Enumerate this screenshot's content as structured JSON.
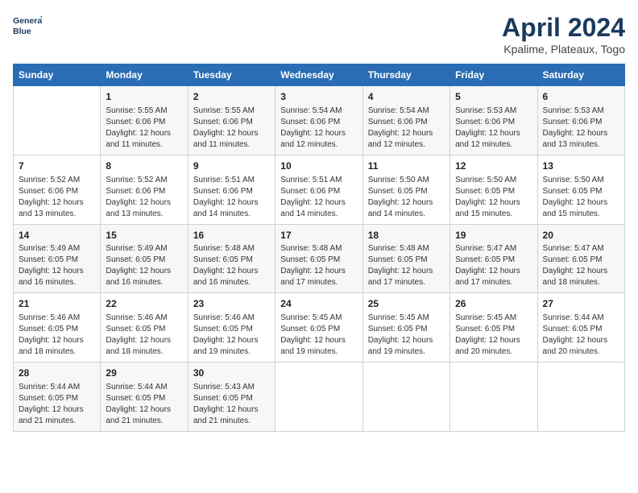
{
  "header": {
    "logo_line1": "General",
    "logo_line2": "Blue",
    "month_title": "April 2024",
    "location": "Kpalime, Plateaux, Togo"
  },
  "days_of_week": [
    "Sunday",
    "Monday",
    "Tuesday",
    "Wednesday",
    "Thursday",
    "Friday",
    "Saturday"
  ],
  "weeks": [
    [
      {
        "day": "",
        "info": ""
      },
      {
        "day": "1",
        "info": "Sunrise: 5:55 AM\nSunset: 6:06 PM\nDaylight: 12 hours\nand 11 minutes."
      },
      {
        "day": "2",
        "info": "Sunrise: 5:55 AM\nSunset: 6:06 PM\nDaylight: 12 hours\nand 11 minutes."
      },
      {
        "day": "3",
        "info": "Sunrise: 5:54 AM\nSunset: 6:06 PM\nDaylight: 12 hours\nand 12 minutes."
      },
      {
        "day": "4",
        "info": "Sunrise: 5:54 AM\nSunset: 6:06 PM\nDaylight: 12 hours\nand 12 minutes."
      },
      {
        "day": "5",
        "info": "Sunrise: 5:53 AM\nSunset: 6:06 PM\nDaylight: 12 hours\nand 12 minutes."
      },
      {
        "day": "6",
        "info": "Sunrise: 5:53 AM\nSunset: 6:06 PM\nDaylight: 12 hours\nand 13 minutes."
      }
    ],
    [
      {
        "day": "7",
        "info": "Sunrise: 5:52 AM\nSunset: 6:06 PM\nDaylight: 12 hours\nand 13 minutes."
      },
      {
        "day": "8",
        "info": "Sunrise: 5:52 AM\nSunset: 6:06 PM\nDaylight: 12 hours\nand 13 minutes."
      },
      {
        "day": "9",
        "info": "Sunrise: 5:51 AM\nSunset: 6:06 PM\nDaylight: 12 hours\nand 14 minutes."
      },
      {
        "day": "10",
        "info": "Sunrise: 5:51 AM\nSunset: 6:06 PM\nDaylight: 12 hours\nand 14 minutes."
      },
      {
        "day": "11",
        "info": "Sunrise: 5:50 AM\nSunset: 6:05 PM\nDaylight: 12 hours\nand 14 minutes."
      },
      {
        "day": "12",
        "info": "Sunrise: 5:50 AM\nSunset: 6:05 PM\nDaylight: 12 hours\nand 15 minutes."
      },
      {
        "day": "13",
        "info": "Sunrise: 5:50 AM\nSunset: 6:05 PM\nDaylight: 12 hours\nand 15 minutes."
      }
    ],
    [
      {
        "day": "14",
        "info": "Sunrise: 5:49 AM\nSunset: 6:05 PM\nDaylight: 12 hours\nand 16 minutes."
      },
      {
        "day": "15",
        "info": "Sunrise: 5:49 AM\nSunset: 6:05 PM\nDaylight: 12 hours\nand 16 minutes."
      },
      {
        "day": "16",
        "info": "Sunrise: 5:48 AM\nSunset: 6:05 PM\nDaylight: 12 hours\nand 16 minutes."
      },
      {
        "day": "17",
        "info": "Sunrise: 5:48 AM\nSunset: 6:05 PM\nDaylight: 12 hours\nand 17 minutes."
      },
      {
        "day": "18",
        "info": "Sunrise: 5:48 AM\nSunset: 6:05 PM\nDaylight: 12 hours\nand 17 minutes."
      },
      {
        "day": "19",
        "info": "Sunrise: 5:47 AM\nSunset: 6:05 PM\nDaylight: 12 hours\nand 17 minutes."
      },
      {
        "day": "20",
        "info": "Sunrise: 5:47 AM\nSunset: 6:05 PM\nDaylight: 12 hours\nand 18 minutes."
      }
    ],
    [
      {
        "day": "21",
        "info": "Sunrise: 5:46 AM\nSunset: 6:05 PM\nDaylight: 12 hours\nand 18 minutes."
      },
      {
        "day": "22",
        "info": "Sunrise: 5:46 AM\nSunset: 6:05 PM\nDaylight: 12 hours\nand 18 minutes."
      },
      {
        "day": "23",
        "info": "Sunrise: 5:46 AM\nSunset: 6:05 PM\nDaylight: 12 hours\nand 19 minutes."
      },
      {
        "day": "24",
        "info": "Sunrise: 5:45 AM\nSunset: 6:05 PM\nDaylight: 12 hours\nand 19 minutes."
      },
      {
        "day": "25",
        "info": "Sunrise: 5:45 AM\nSunset: 6:05 PM\nDaylight: 12 hours\nand 19 minutes."
      },
      {
        "day": "26",
        "info": "Sunrise: 5:45 AM\nSunset: 6:05 PM\nDaylight: 12 hours\nand 20 minutes."
      },
      {
        "day": "27",
        "info": "Sunrise: 5:44 AM\nSunset: 6:05 PM\nDaylight: 12 hours\nand 20 minutes."
      }
    ],
    [
      {
        "day": "28",
        "info": "Sunrise: 5:44 AM\nSunset: 6:05 PM\nDaylight: 12 hours\nand 21 minutes."
      },
      {
        "day": "29",
        "info": "Sunrise: 5:44 AM\nSunset: 6:05 PM\nDaylight: 12 hours\nand 21 minutes."
      },
      {
        "day": "30",
        "info": "Sunrise: 5:43 AM\nSunset: 6:05 PM\nDaylight: 12 hours\nand 21 minutes."
      },
      {
        "day": "",
        "info": ""
      },
      {
        "day": "",
        "info": ""
      },
      {
        "day": "",
        "info": ""
      },
      {
        "day": "",
        "info": ""
      }
    ]
  ]
}
